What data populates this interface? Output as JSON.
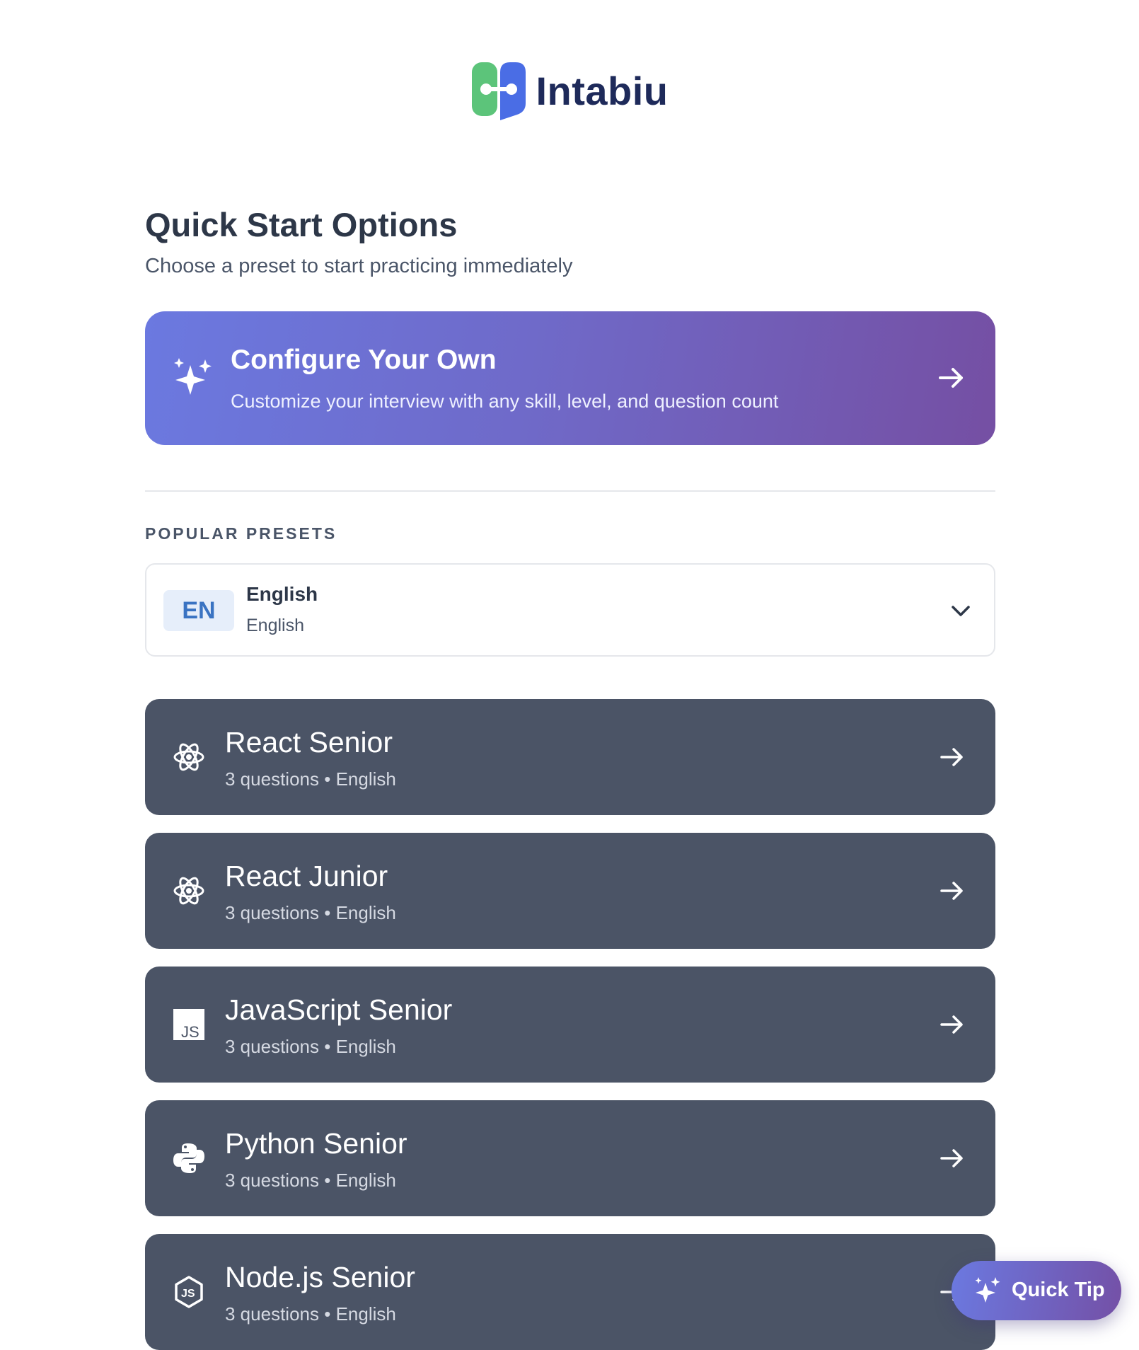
{
  "brand": {
    "name": "Intabiu",
    "mark_colors": [
      "#5cc47a",
      "#4a6de5"
    ]
  },
  "header": {
    "title": "Quick Start Options",
    "subtitle": "Choose a preset to start practicing immediately"
  },
  "configure": {
    "icon": "sparkles-icon",
    "title": "Configure Your Own",
    "description": "Customize your interview with any skill, level, and question count",
    "arrow_icon": "arrow-right-icon"
  },
  "presets_section": {
    "label": "POPULAR PRESETS"
  },
  "language_select": {
    "code": "EN",
    "name": "English",
    "native_name": "English",
    "icon": "chevron-down-icon"
  },
  "presets": [
    {
      "title": "React Senior",
      "questions": "3 questions",
      "language": "English",
      "icon": "react-icon"
    },
    {
      "title": "React Junior",
      "questions": "3 questions",
      "language": "English",
      "icon": "react-icon"
    },
    {
      "title": "JavaScript Senior",
      "questions": "3 questions",
      "language": "English",
      "icon": "javascript-icon"
    },
    {
      "title": "Python Senior",
      "questions": "3 questions",
      "language": "English",
      "icon": "python-icon"
    },
    {
      "title": "Node.js Senior",
      "questions": "3 questions",
      "language": "English",
      "icon": "nodejs-icon"
    }
  ],
  "meta_separator": "•",
  "quick_tip": {
    "label": "Quick Tip",
    "icon": "sparkles-icon"
  },
  "colors": {
    "accent_start": "#6b79e0",
    "accent_end": "#754fa3",
    "preset_bg": "#4b5466",
    "heading": "#2d3748"
  }
}
